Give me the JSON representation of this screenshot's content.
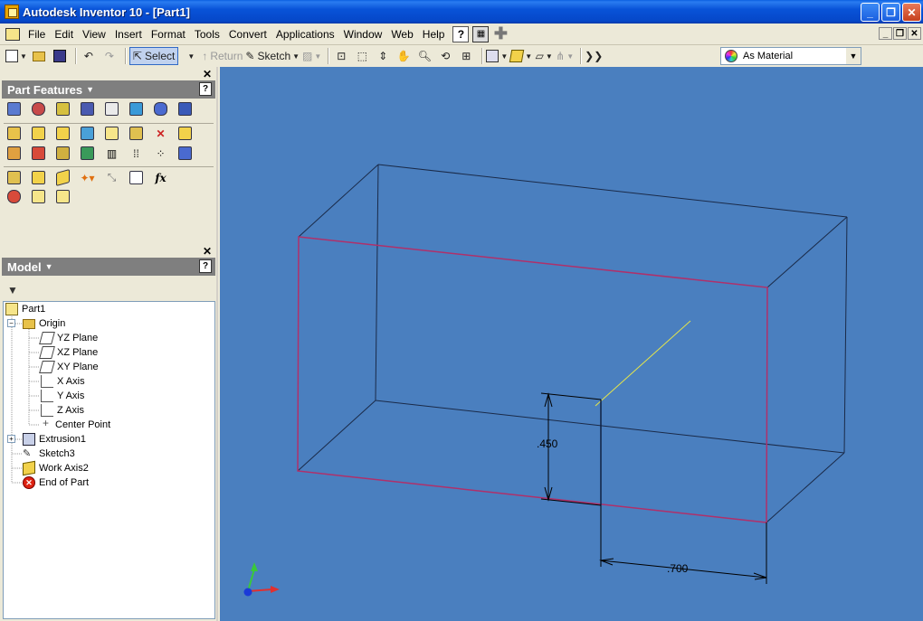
{
  "window": {
    "title": "Autodesk Inventor 10 - [Part1]",
    "min_label": "_",
    "restore_label": "❐",
    "close_label": "✕"
  },
  "menu": {
    "items": [
      "File",
      "Edit",
      "View",
      "Insert",
      "Format",
      "Tools",
      "Convert",
      "Applications",
      "Window",
      "Web",
      "Help"
    ]
  },
  "toolbar": {
    "select_label": "Select",
    "return_label": "Return",
    "sketch_label": "Sketch",
    "material_value": "As Material"
  },
  "part_features": {
    "title": "Part Features",
    "help": "?"
  },
  "model_browser": {
    "title": "Model",
    "help": "?",
    "nodes": {
      "part": "Part1",
      "origin": "Origin",
      "yz": "YZ Plane",
      "xz": "XZ Plane",
      "xy": "XY Plane",
      "xaxis": "X Axis",
      "yaxis": "Y Axis",
      "zaxis": "Z Axis",
      "center": "Center Point",
      "extrusion": "Extrusion1",
      "sketch": "Sketch3",
      "workaxis": "Work Axis2",
      "end": "End of Part"
    }
  },
  "viewport": {
    "dim_vertical": ".450",
    "dim_horizontal": ".700",
    "background": "#4a7fbf"
  }
}
